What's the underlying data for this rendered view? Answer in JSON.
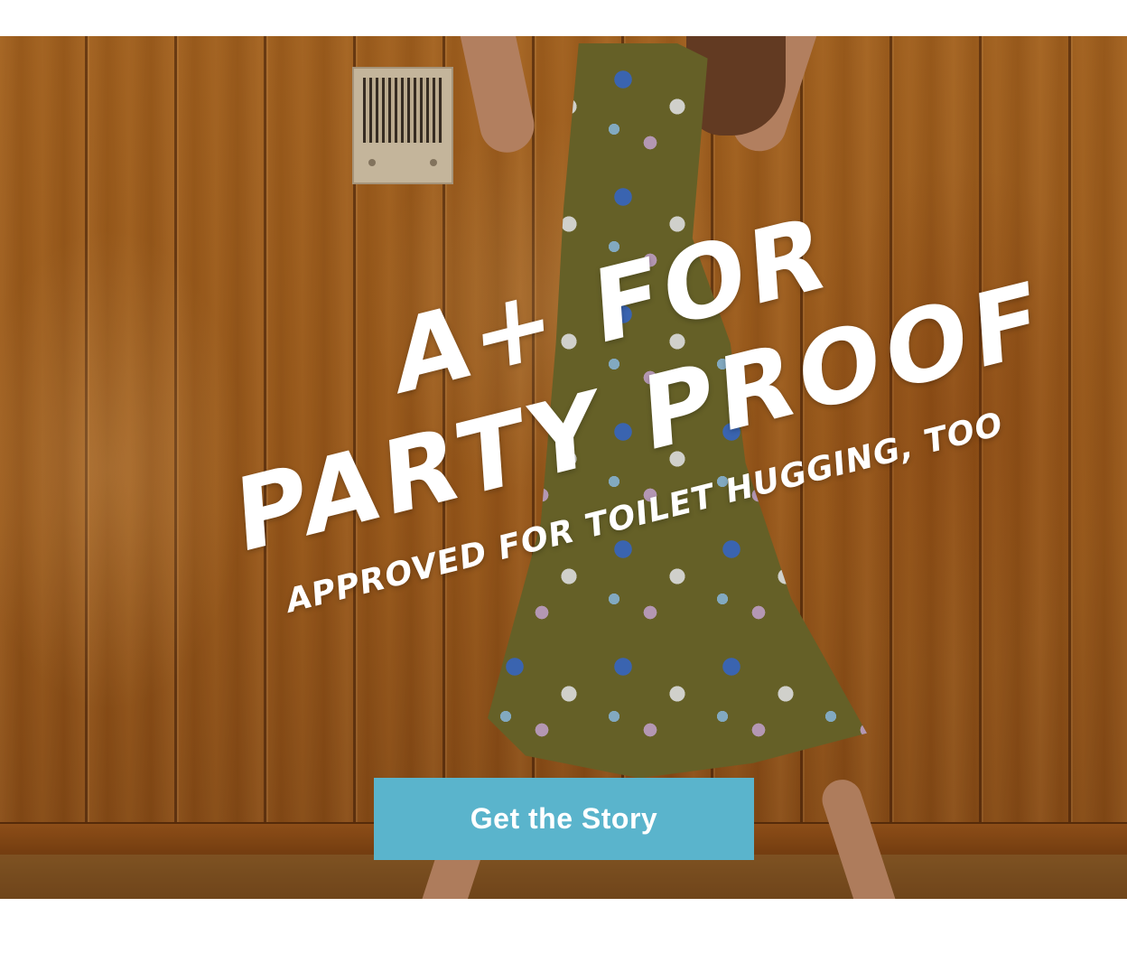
{
  "hero": {
    "headline_line1": "A+ FOR",
    "headline_line2": "PARTY PROOF",
    "subheadline": "APPROVED FOR TOILET HUGGING, TOO",
    "cta_label": "Get the Story"
  },
  "colors": {
    "cta_background": "#5ab4cc",
    "headline_text": "#ffffff",
    "page_background": "#ffffff",
    "wood_panel": "#a45f1c"
  }
}
